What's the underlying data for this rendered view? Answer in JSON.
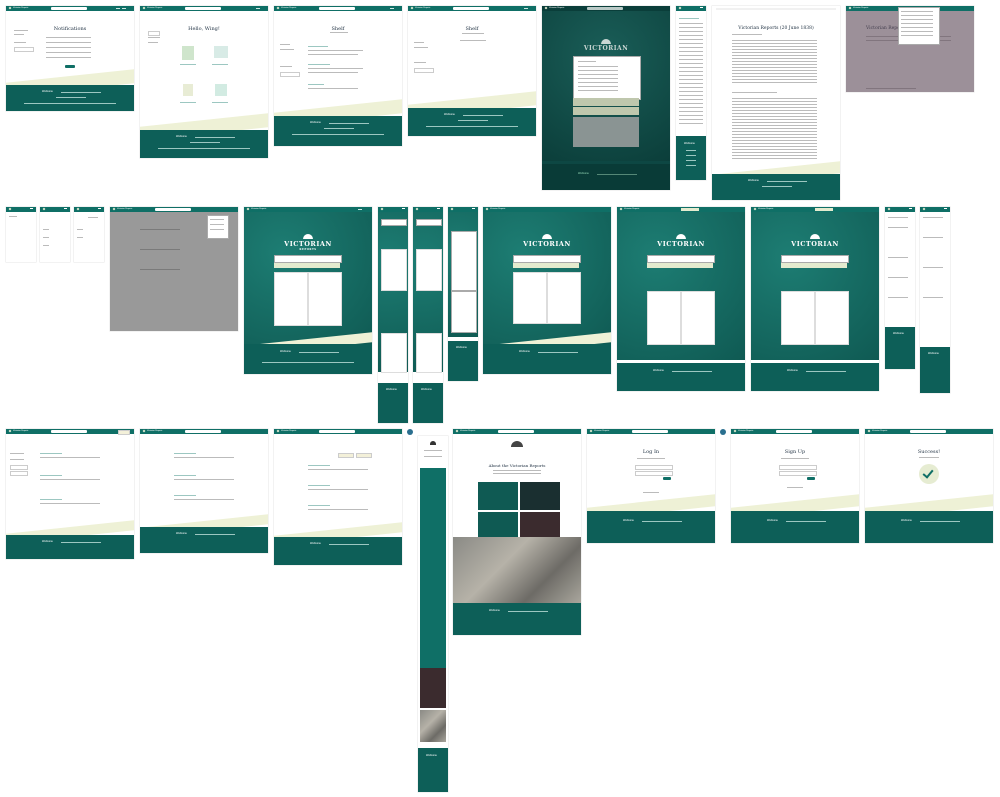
{
  "brand": "Victorian Reports",
  "colors": {
    "primary": "#0f6f66",
    "footer": "#0d5f58",
    "cream": "#eef1d6",
    "overlay": "#555555"
  },
  "icons": {
    "logo": "quill-icon",
    "menu": "hamburger-icon",
    "settings": "gear-icon",
    "success": "checkmark-icon",
    "search": "search-icon"
  },
  "pages": {
    "notifications": {
      "title": "Notifications"
    },
    "hello": {
      "title": "Hello, Wing!"
    },
    "shelf": {
      "title": "Shelf"
    },
    "reports": {
      "title": "Victorian Reports (20 June 1838)"
    },
    "reports_overlay": {
      "title": "Victorian Repo"
    },
    "about": {
      "title": "About the Victorian Reports"
    },
    "login": {
      "title": "Log In"
    },
    "signup": {
      "title": "Sign Up"
    },
    "success": {
      "title": "Success!"
    }
  },
  "hero": {
    "wordmark": "VICTORIAN",
    "sub": "REPORTS"
  },
  "footer": {
    "publisher": "Wellcome",
    "links": [
      "Documentation",
      "About",
      "Privacy",
      "Terms"
    ]
  }
}
